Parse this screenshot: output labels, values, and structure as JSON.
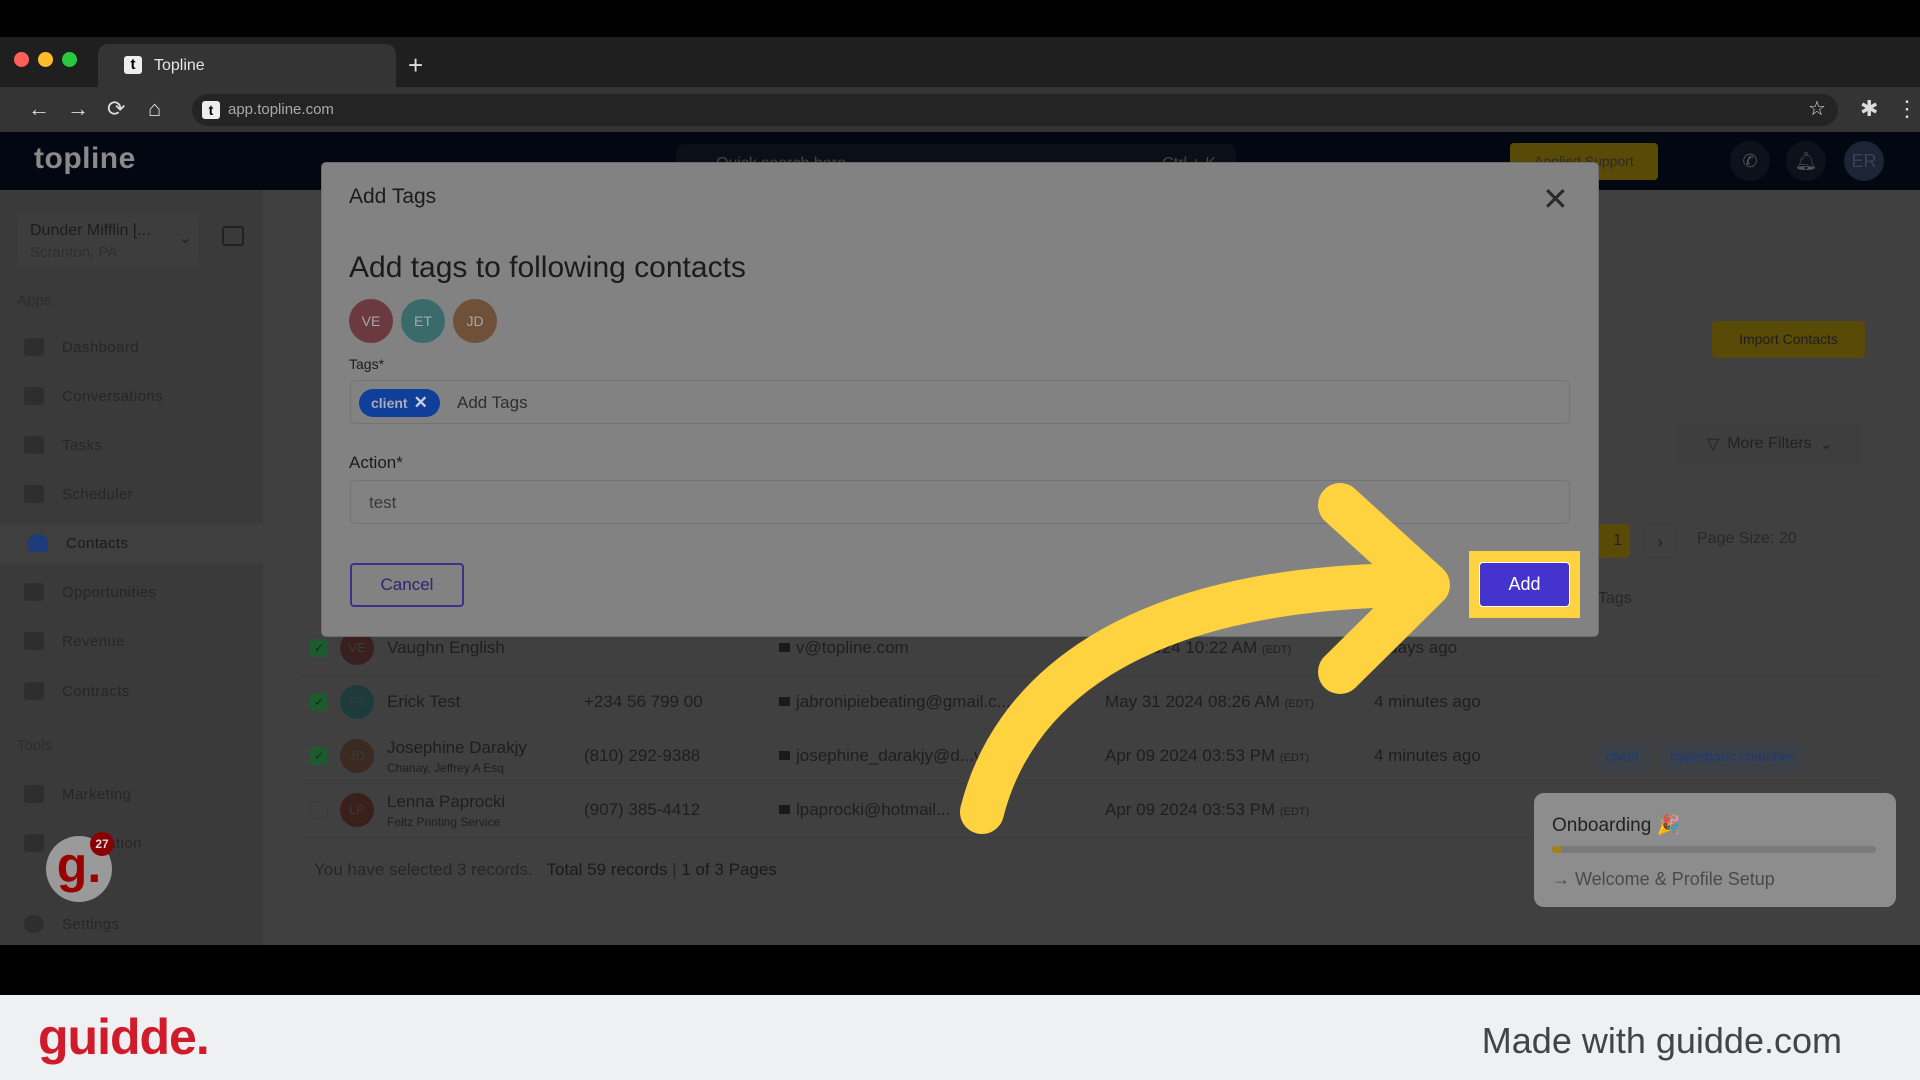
{
  "browser": {
    "tab_title": "Topline",
    "tab_favicon": "t",
    "url": "app.topline.com",
    "new_tab": "+",
    "back": "←",
    "forward": "→",
    "reload": "⟳",
    "home": "⌂",
    "star": "☆",
    "extensions": "✱",
    "menu": "⋮"
  },
  "header": {
    "logo": "topline",
    "search_placeholder": "Quick search here",
    "search_shortcut": "Ctrl + K",
    "support_button": "Applied Support",
    "avatar": "ER"
  },
  "sidebar": {
    "company_name": "Dunder Mifflin [...",
    "company_location": "Scranton, PA",
    "apps_label": "Apps",
    "apps": [
      {
        "label": "Dashboard"
      },
      {
        "label": "Conversations"
      },
      {
        "label": "Tasks"
      },
      {
        "label": "Scheduler"
      },
      {
        "label": "Contacts"
      },
      {
        "label": "Opportunities"
      },
      {
        "label": "Revenue"
      },
      {
        "label": "Contracts"
      }
    ],
    "tools_label": "Tools",
    "tools": [
      {
        "label": "Marketing"
      },
      {
        "label": "Automation"
      },
      {
        "label": "Settings"
      }
    ]
  },
  "contacts_page": {
    "import_button": "Import Contacts",
    "more_filters": "More Filters",
    "current_page": "1",
    "page_size": "Page Size: 20",
    "tags_column": "Tags",
    "rows": [
      {
        "initials": "VE",
        "name": "Vaughn English",
        "company": "",
        "phone": "",
        "email": "v@topline.com",
        "created": "...04 2024 10:22 AM",
        "tz": "(EDT)",
        "updated": "...days ago",
        "checked": true,
        "tags": []
      },
      {
        "initials": "ET",
        "name": "Erick Test",
        "company": "",
        "phone": "+234 56 799 00",
        "email": "jabronipiebeating@gmail.c...",
        "created": "May 31 2024 08:26 AM",
        "tz": "(EDT)",
        "updated": "4 minutes ago",
        "checked": true,
        "tags": []
      },
      {
        "initials": "JD",
        "name": "Josephine Darakjy",
        "company": "Chanay, Jeffrey A Esq",
        "phone": "(810) 292-9388",
        "email": "josephine_darakjy@d...y.org",
        "created": "Apr 09 2024 03:53 PM",
        "tz": "(EDT)",
        "updated": "4 minutes ago",
        "checked": true,
        "tags": [
          "client",
          "hyperbaric chamber"
        ]
      },
      {
        "initials": "LP",
        "name": "Lenna Paprocki",
        "company": "Feltz Printing Service",
        "phone": "(907) 385-4412",
        "email": "lpaprocki@hotmail...",
        "created": "Apr 09 2024 03:53 PM",
        "tz": "(EDT)",
        "updated": "",
        "checked": false,
        "tags": []
      }
    ],
    "selection_text": "You have selected 3 records.",
    "total_text": "Total 59 records",
    "pages_text": "1 of 3 Pages"
  },
  "onboarding": {
    "title": "Onboarding 🎉",
    "progress": 0.03,
    "step": "→ Welcome & Profile Setup"
  },
  "modal": {
    "title": "Add Tags",
    "close": "✕",
    "heading": "Add tags to following contacts",
    "avatars": [
      "VE",
      "ET",
      "JD"
    ],
    "tags_label": "Tags*",
    "tag_chip": "client",
    "tags_placeholder": "Add Tags",
    "action_label": "Action*",
    "action_value": "test",
    "cancel_button": "Cancel",
    "add_button": "Add"
  },
  "guidde_widget": {
    "letter": "g.",
    "badge": "27"
  },
  "branding": {
    "logo": "guidde.",
    "made_with": "Made with guidde.com"
  },
  "colors": {
    "accent": "#4433cc",
    "highlight": "#ffd240",
    "brand_red": "#d11a2a"
  }
}
